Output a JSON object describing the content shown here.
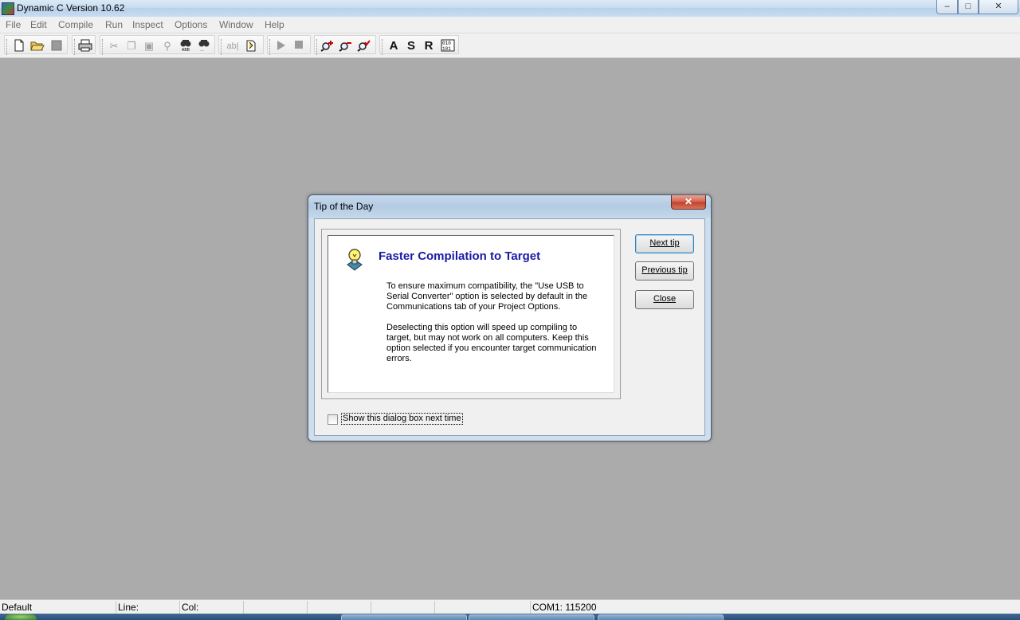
{
  "window": {
    "title": "Dynamic C Version 10.62",
    "controls": {
      "minimize": "–",
      "maximize": "□",
      "close": "✕"
    }
  },
  "menu": {
    "items": [
      "File",
      "Edit",
      "Compile",
      "Run",
      "Inspect",
      "Options",
      "Window",
      "Help"
    ]
  },
  "toolbar": {
    "icons": [
      "new-file-icon",
      "open-folder-icon",
      "save-icon",
      "print-icon",
      "cut-icon",
      "copy-icon",
      "paste-icon",
      "find-icon",
      "find-next-icon",
      "find-prev-icon",
      "replace-icon",
      "goto-icon",
      "run-icon",
      "stop-icon",
      "zoom-in-icon",
      "zoom-out-icon",
      "zoom-check-icon"
    ],
    "letters": [
      "A",
      "S",
      "R"
    ]
  },
  "dialog": {
    "title": "Tip of the Day",
    "close_glyph": "✕",
    "tip_heading": "Faster Compilation to Target",
    "tip_paragraph_1": "To ensure maximum compatibility, the \"Use USB to\nSerial Converter\" option is selected by default in the\nCommunications tab of your Project Options.",
    "tip_paragraph_2": "Deselecting this option will speed up compiling to\ntarget, but may not work on all computers.  Keep this\noption selected if you encounter target communication\nerrors.",
    "buttons": {
      "next_tip": "Next tip",
      "previous_tip": "Previous tip",
      "close": "Close"
    },
    "checkbox_label": "Show this dialog box next time",
    "checkbox_checked": false
  },
  "statusbar": {
    "mode": "Default",
    "line_label": "Line:",
    "col_label": "Col:",
    "port": "COM1: 115200"
  },
  "colors": {
    "workspace": "#ababab",
    "tip_heading": "#1a1aa6"
  }
}
